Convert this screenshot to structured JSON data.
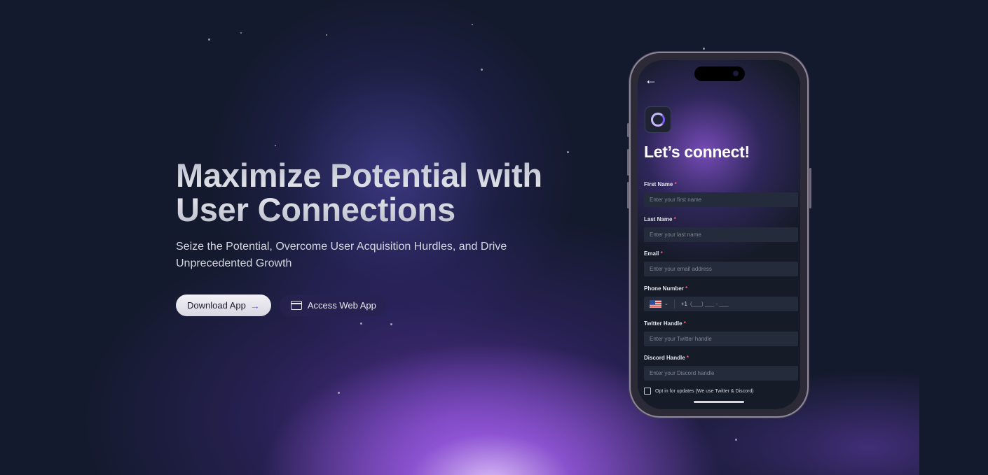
{
  "hero": {
    "title": "Maximize Potential with User Connections",
    "subtitle": "Seize the Potential, Overcome User Acquisition Hurdles, and Drive Unprecedented Growth",
    "download_label": "Download App",
    "download_arrow": "→",
    "web_label": "Access Web App"
  },
  "phone": {
    "back": "←",
    "title": "Let’s connect!",
    "required_marker": "*",
    "fields": [
      {
        "label": "First Name",
        "placeholder": "Enter your first name"
      },
      {
        "label": "Last Name",
        "placeholder": "Enter your last name"
      },
      {
        "label": "Email",
        "placeholder": "Enter your email address"
      },
      {
        "label": "Phone Number",
        "placeholder": "(___) ___ - ___"
      },
      {
        "label": "Twitter Handle",
        "placeholder": "Enter your Twitter handle"
      },
      {
        "label": "Discord Handle",
        "placeholder": "Enter your Discord handle"
      }
    ],
    "dial_code": "+1",
    "country_icon": "us-flag-icon",
    "opt_in_label": "Opt in for updates (We use Twitter & Discord)"
  },
  "colors": {
    "background": "#141a2e",
    "accent": "#7e5cf0",
    "required": "#ff5a7a"
  }
}
